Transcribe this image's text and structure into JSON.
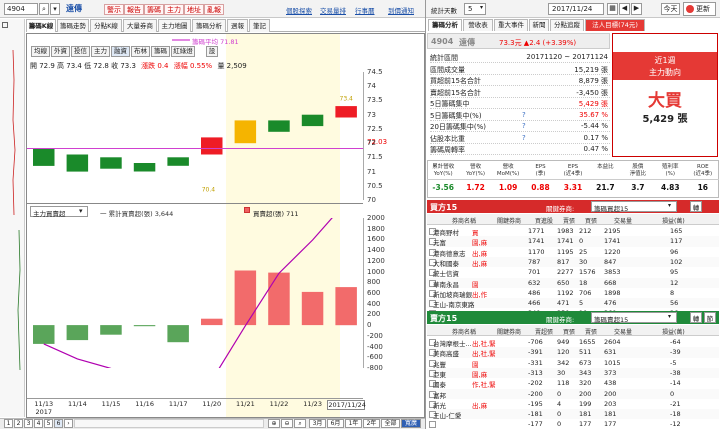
{
  "toolbar": {
    "code": "4904",
    "buttons": [
      "警示",
      "報告",
      "籌碼",
      "主力",
      "地址",
      "亂報"
    ],
    "links": [
      "個股探索",
      "交易量排",
      "行事曆",
      "到價通知"
    ]
  },
  "left_tabs": [
    "籌碼K線",
    "籌碼走勢",
    "分點K線",
    "大量券商",
    "主力地圖",
    "籌碼分析",
    "週報",
    "筆記"
  ],
  "sub_buttons": [
    "均線",
    "外資",
    "投信",
    "主力",
    "融資",
    "布林",
    "籌碼",
    "紅綠燈",
    "設"
  ],
  "legend_ma": "籌碼平均 71.81",
  "ohlc": {
    "text": "開 72.9  高 73.4  低 72.8  收 73.3",
    "change": "漲跌 0.4",
    "pct": "漲幅 0.55%",
    "vol": "量 2,509"
  },
  "upper_axis": [
    "74.5",
    "74",
    "73.5",
    "73",
    "72.5",
    "72.03",
    "72",
    "71.5",
    "71",
    "70.5",
    "70"
  ],
  "upper_labels": {
    "high": "73.4",
    "low": "70.4"
  },
  "lower_dropdown": "主力買賣超",
  "lower_legend": {
    "cum": "一 累計買賣超(張) 3,644",
    "daily": "買賣超(張) 711"
  },
  "lower_axis": [
    "2000",
    "1800",
    "1600",
    "1400",
    "1200",
    "1000",
    "800",
    "600",
    "400",
    "200",
    "0",
    "-200",
    "-400",
    "-600",
    "-800"
  ],
  "dates": [
    "11/13\n2017",
    "11/14",
    "11/15",
    "11/16",
    "11/17",
    "11/20",
    "11/21",
    "11/22",
    "11/23",
    "2017/11/24"
  ],
  "date_labels": [
    "11/13",
    "2017",
    "11/14",
    "11/15",
    "11/16",
    "11/17",
    "11/20",
    "11/21",
    "11/22",
    "11/23",
    "2017/11/24"
  ],
  "chart_data": [
    {
      "type": "bar",
      "title": "",
      "categories": [
        "11/13",
        "11/14",
        "11/15",
        "11/16",
        "11/17",
        "11/20",
        "11/21",
        "11/22",
        "11/23",
        "11/24"
      ],
      "series": [
        {
          "name": "",
          "open": [
            71.2,
            71.0,
            71.1,
            71.0,
            71.2,
            71.6,
            72.0,
            72.8,
            73.0,
            72.9
          ],
          "close": [
            71.8,
            71.6,
            71.5,
            71.3,
            71.5,
            72.2,
            72.8,
            72.4,
            72.6,
            73.3
          ]
        }
      ],
      "ylim": [
        70,
        74.5
      ]
    },
    {
      "type": "bar",
      "title": "",
      "categories": [
        "11/13",
        "11/14",
        "11/15",
        "11/16",
        "11/17",
        "11/20",
        "11/21",
        "11/22",
        "11/23",
        "11/24"
      ],
      "series": [
        {
          "name": "買賣超(張)",
          "values": [
            -350,
            -280,
            -180,
            -20,
            -320,
            120,
            1020,
            980,
            620,
            711
          ]
        },
        {
          "name": "累計買賣超(張)",
          "values": [
            -350,
            -630,
            -810,
            -830,
            -1150,
            -1030,
            -10,
            970,
            1590,
            2300
          ]
        }
      ],
      "ylim": [
        -800,
        2000
      ]
    }
  ],
  "bottom_nav": {
    "pages": [
      "1",
      "2",
      "3",
      "4",
      "5",
      "6"
    ],
    "ranges": [
      "3月",
      "6月",
      "1年",
      "2年",
      "全部",
      "寬廣"
    ]
  },
  "right_top": {
    "label": "統計天數",
    "days": "5",
    "date": "2017/11/24",
    "today": "今天",
    "update": "更新"
  },
  "right_tabs": [
    "籌碼分析",
    "營收表",
    "重大事件",
    "新聞",
    "分點追蹤",
    "法人目標(74元)"
  ],
  "info": {
    "code": "4904",
    "name": "遠傳",
    "price": "73.3元 ▲2.4 (+3.39%)",
    "rows": [
      [
        "統計區間",
        "20171120 ~ 20171124"
      ],
      [
        "區間成交量",
        "15,219 張"
      ],
      [
        "買超前15名合計",
        "8,879 張"
      ],
      [
        "賣超前15名合計",
        "-3,450 張"
      ],
      [
        "5日籌碼集中",
        "5,429 張"
      ],
      [
        "5日籌碼集中(%)",
        "35.67 %"
      ],
      [
        "20日籌碼集中(%)",
        "-5.44 %"
      ],
      [
        "佔股本比重",
        "0.17 %"
      ],
      [
        "籌碼周轉率",
        "0.47 %"
      ]
    ]
  },
  "big": {
    "period": "近1週",
    "sub": "主力動向",
    "verdict": "大買",
    "amount": "5,429 張"
  },
  "stats": {
    "headers": [
      "累計營收\nYoY(%)",
      "營收\nYoY(%)",
      "營收\nMoM(%)",
      "EPS\n(季)",
      "EPS\n(近4季)",
      "本益比",
      "股價\n淨值比",
      "殖利率\n(%)",
      "ROE\n(近4季)"
    ],
    "values": [
      "-3.56",
      "1.72",
      "1.09",
      "0.88",
      "3.31",
      "21.7",
      "3.7",
      "4.83",
      "16"
    ]
  },
  "buy": {
    "title": "買方15",
    "filter": "關鍵券商:",
    "sel": "籌碼買超15",
    "btn": "轉",
    "cols": [
      "券商名稱",
      "關鍵券商",
      "買進股",
      "賣張",
      "買張",
      "交易量",
      "損益(萬)"
    ],
    "rows": [
      [
        "港商野村",
        "買",
        "1771",
        "1983",
        "212",
        "2195",
        "165"
      ],
      [
        "元富",
        "園,麻",
        "1741",
        "1741",
        "0",
        "1741",
        "117"
      ],
      [
        "港商德意志",
        "出,麻",
        "1170",
        "1195",
        "25",
        "1220",
        "96"
      ],
      [
        "大和國泰",
        "出,麻",
        "787",
        "817",
        "30",
        "847",
        "102"
      ],
      [
        "統士信資",
        "",
        "701",
        "2277",
        "1576",
        "3853",
        "95"
      ],
      [
        "華南永昌",
        "園",
        "632",
        "650",
        "18",
        "668",
        "12"
      ],
      [
        "新加坡商瑞銀",
        "出,作",
        "486",
        "1192",
        "706",
        "1898",
        "8"
      ],
      [
        "王山-南京東路",
        "",
        "466",
        "471",
        "5",
        "476",
        "56"
      ],
      [
        "統一-內湖",
        "園",
        "340",
        "350",
        "10",
        "360",
        "26"
      ]
    ]
  },
  "sell": {
    "title": "賣方15",
    "filter": "關鍵券商:",
    "sel": "籌碼賣超15",
    "btn": "轉",
    "btn2": "節",
    "cols": [
      "券商名稱",
      "關鍵券商",
      "賣超張",
      "買張",
      "賣張",
      "交易量",
      "損益(萬)"
    ],
    "rows": [
      [
        "台灣摩根士...",
        "出,社,緊",
        "-706",
        "949",
        "1655",
        "2604",
        "-64"
      ],
      [
        "美商高盛",
        "出,社,緊",
        "-391",
        "120",
        "511",
        "631",
        "-39"
      ],
      [
        "兆豐",
        "園",
        "-331",
        "342",
        "673",
        "1015",
        "-5"
      ],
      [
        "亞東",
        "園,麻",
        "-313",
        "30",
        "343",
        "373",
        "-38"
      ],
      [
        "國泰",
        "作,社,緊",
        "-202",
        "118",
        "320",
        "438",
        "-14"
      ],
      [
        "富邦",
        "",
        "-200",
        "0",
        "200",
        "200",
        "0"
      ],
      [
        "新光",
        "出,麻",
        "-195",
        "4",
        "199",
        "203",
        "-21"
      ],
      [
        "王山-仁愛",
        "",
        "-181",
        "0",
        "181",
        "181",
        "-18"
      ],
      [
        "",
        "",
        "-177",
        "0",
        "177",
        "177",
        "-12"
      ]
    ]
  }
}
